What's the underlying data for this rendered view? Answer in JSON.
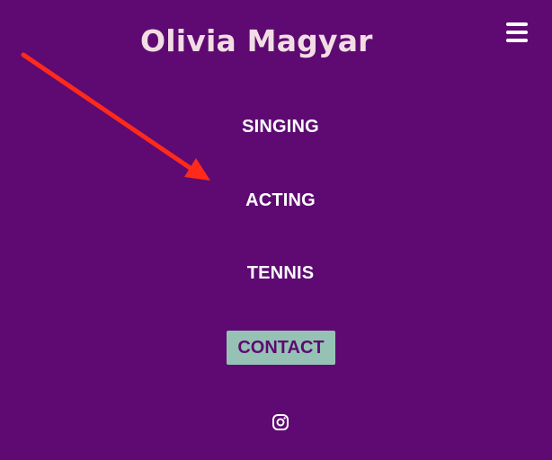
{
  "header": {
    "title": "Olivia Magyar",
    "menu_icon": "hamburger-menu-icon"
  },
  "nav": {
    "items": [
      {
        "label": "SINGING"
      },
      {
        "label": "ACTING"
      },
      {
        "label": "TENNIS"
      }
    ],
    "contact_label": "CONTACT"
  },
  "social": {
    "instagram_icon": "instagram-icon"
  },
  "colors": {
    "background": "#5e0a72",
    "title": "#f3dde4",
    "text": "#ffffff",
    "contact_bg": "#96c2b5",
    "contact_text": "#5e0a72",
    "arrow": "#ff2a1a"
  },
  "annotation": {
    "type": "arrow"
  }
}
